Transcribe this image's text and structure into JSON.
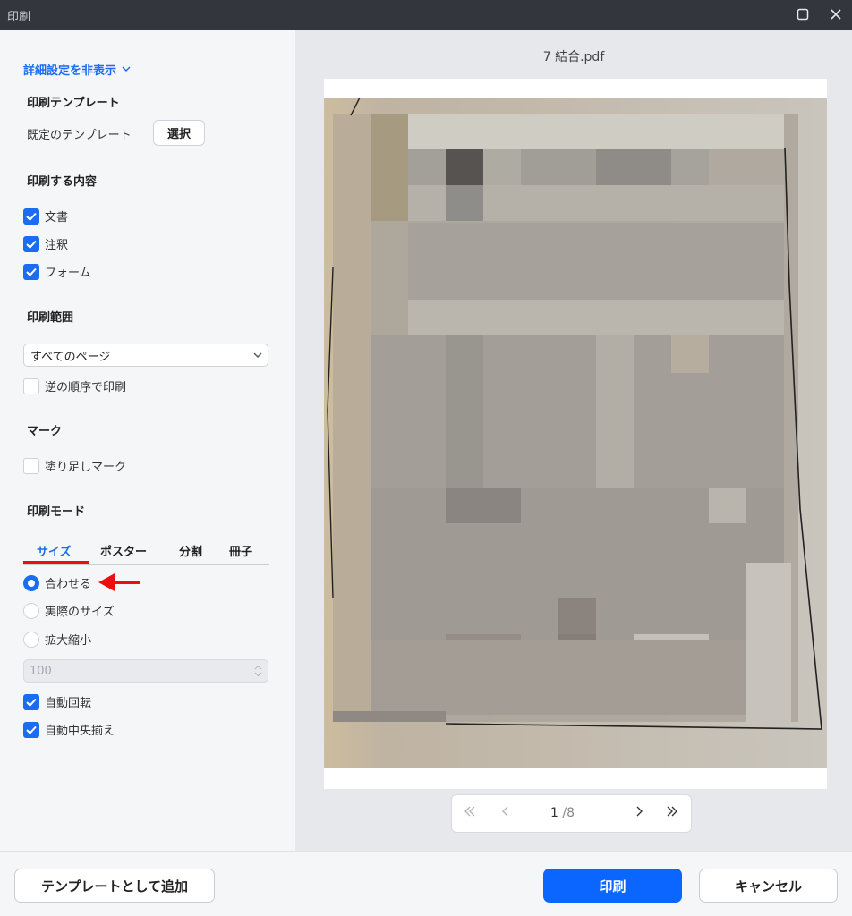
{
  "window": {
    "title": "印刷"
  },
  "settings_toggle": "詳細設定を非表示",
  "template": {
    "heading": "印刷テンプレート",
    "label": "既定のテンプレート",
    "select_button": "選択"
  },
  "content": {
    "heading": "印刷する内容",
    "items": [
      {
        "label": "文書",
        "checked": true
      },
      {
        "label": "注釈",
        "checked": true
      },
      {
        "label": "フォーム",
        "checked": true
      }
    ]
  },
  "range": {
    "heading": "印刷範囲",
    "selected": "すべてのページ",
    "reverse_label": "逆の順序で印刷",
    "reverse_checked": false
  },
  "marks": {
    "heading": "マーク",
    "bleed_label": "塗り足しマーク",
    "bleed_checked": false
  },
  "mode": {
    "heading": "印刷モード",
    "tabs": [
      "サイズ",
      "ポスター",
      "分割",
      "冊子"
    ],
    "active_tab": "サイズ",
    "options": [
      {
        "label": "合わせる",
        "selected": true
      },
      {
        "label": "実際のサイズ",
        "selected": false
      },
      {
        "label": "拡大縮小",
        "selected": false
      }
    ],
    "scale_value": "100",
    "auto_rotate": {
      "label": "自動回転",
      "checked": true
    },
    "auto_center": {
      "label": "自動中央揃え",
      "checked": true
    }
  },
  "preview": {
    "filename": "7 結合.pdf",
    "page_current": "1",
    "page_total": "/8"
  },
  "footer": {
    "add_template": "テンプレートとして追加",
    "print": "印刷",
    "cancel": "キャンセル"
  },
  "colors": {
    "accent": "#1a6df0",
    "primary_button": "#0b66ff",
    "annotation_red": "#ee0e0e",
    "titlebar": "#33373d"
  }
}
